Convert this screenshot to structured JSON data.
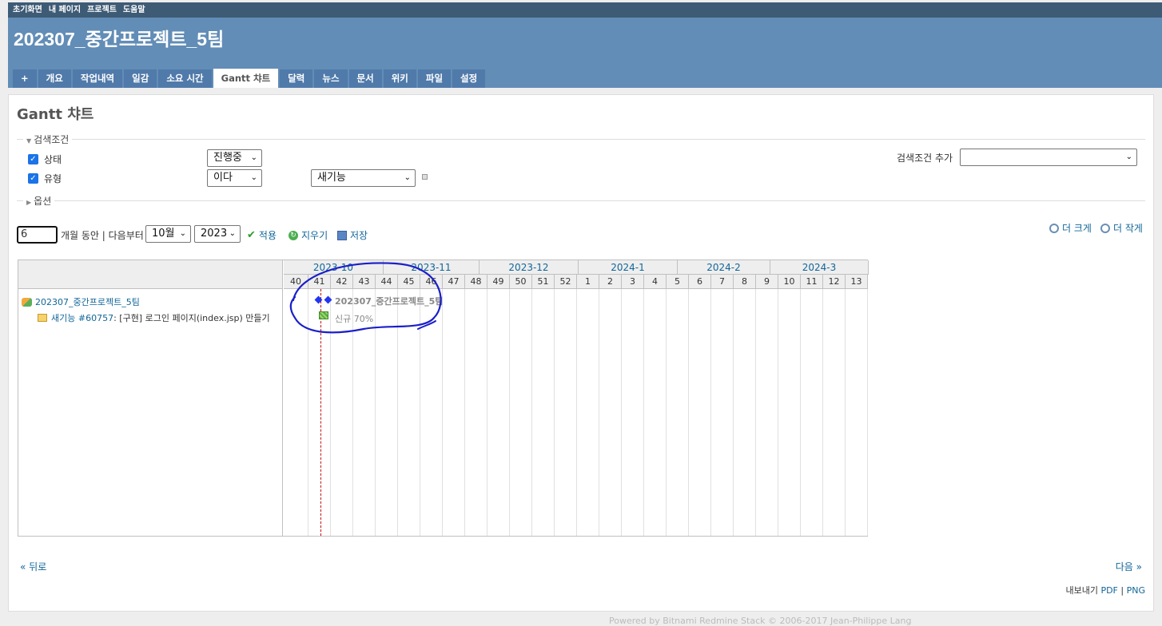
{
  "top_menu": [
    "초기화면",
    "내 페이지",
    "프로젝트",
    "도움말"
  ],
  "project_title": "202307_중간프로젝트_5팀",
  "tabs": [
    {
      "label": "+"
    },
    {
      "label": "개요"
    },
    {
      "label": "작업내역"
    },
    {
      "label": "일감"
    },
    {
      "label": "소요 시간"
    },
    {
      "label": "Gantt 챠트"
    },
    {
      "label": "달력"
    },
    {
      "label": "뉴스"
    },
    {
      "label": "문서"
    },
    {
      "label": "위키"
    },
    {
      "label": "파일"
    },
    {
      "label": "설정"
    }
  ],
  "page_title": "Gantt 챠트",
  "filters": {
    "legend": "검색조건",
    "status_label": "상태",
    "status_value": "진행중",
    "type_label": "유형",
    "type_operator": "이다",
    "type_value": "새기능",
    "add_filter_label": "검색조건 추가",
    "add_filter_value": ""
  },
  "options_legend": "옵션",
  "controls": {
    "months_value": "6",
    "months_text": "개월 동안 | 다음부터",
    "month_select": "10월",
    "year_select": "2023",
    "apply": "적용",
    "clear": "지우기",
    "save": "저장",
    "zoom_in": "더 크게",
    "zoom_out": "더 작게"
  },
  "gantt": {
    "months": [
      "2023-10",
      "2023-11",
      "2023-12",
      "2024-1",
      "2024-2",
      "2024-3"
    ],
    "weeks": [
      "40",
      "41",
      "42",
      "43",
      "44",
      "45",
      "46",
      "47",
      "48",
      "49",
      "50",
      "51",
      "52",
      "1",
      "2",
      "3",
      "4",
      "5",
      "6",
      "7",
      "8",
      "9",
      "10",
      "11",
      "12",
      "13"
    ],
    "project_row": "202307_중간프로젝트_5팀",
    "issue_tracker": "새기능 #60757",
    "issue_subject": ": [구현] 로그인 페이지(index.jsp) 만들기",
    "project_bar_label": "202307_중간프로젝트_5팀",
    "issue_bar_label": "신규 70%"
  },
  "pagination": {
    "prev": "« 뒤로",
    "next": "다음 »"
  },
  "export": {
    "label": "내보내기",
    "pdf": "PDF",
    "sep": "|",
    "png": "PNG"
  },
  "footer": "Powered by Bitnami Redmine Stack © 2006-2017 Jean-Philippe Lang",
  "colors": {
    "header": "#628db6",
    "top_menu": "#3e5b76",
    "tab": "#507aaa",
    "annotation": "#1a1fc9"
  }
}
